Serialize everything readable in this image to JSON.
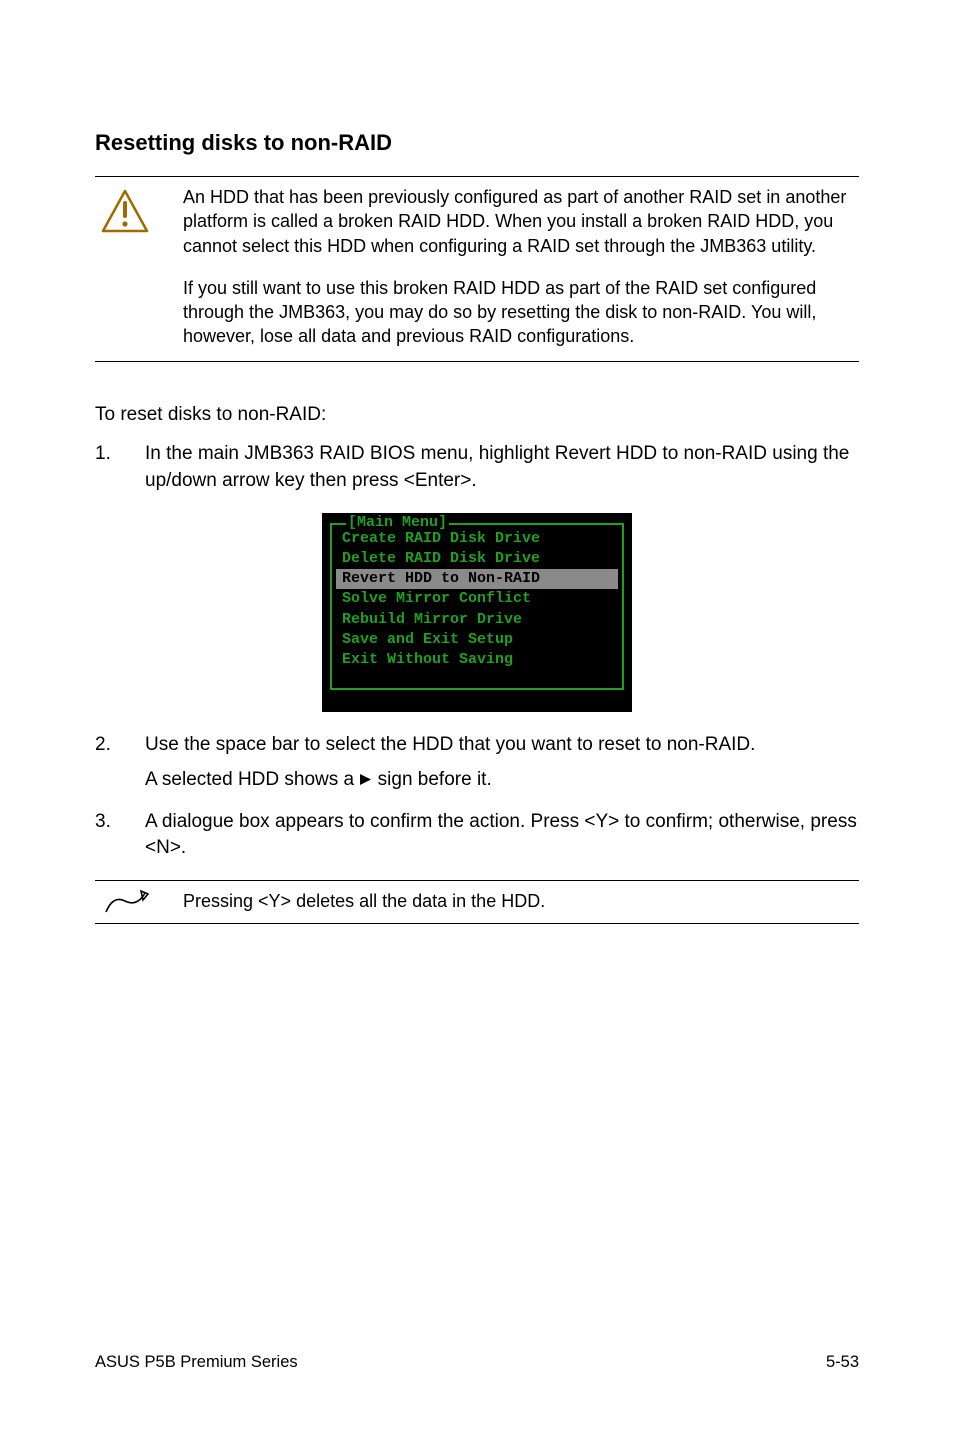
{
  "heading": "Resetting disks to non-RAID",
  "warning": {
    "p1": "An HDD that has been previously configured as part of another RAID set in another platform is called a broken RAID HDD. When you install a broken RAID HDD, you cannot select this HDD when configuring a RAID set through the JMB363 utility.",
    "p2": "If you still want to use this broken RAID HDD as part of the RAID set configured through the JMB363, you may do so by resetting the disk to non-RAID. You will, however, lose all data and previous RAID configurations."
  },
  "intro": "To reset disks to non-RAID:",
  "steps": {
    "s1": {
      "num": "1.",
      "text": "In the main JMB363 RAID BIOS menu, highlight Revert HDD to non-RAID using the up/down arrow key then press <Enter>."
    },
    "s2": {
      "num": "2.",
      "line1": "Use the space bar to select the HDD that you want to reset to non-RAID.",
      "line2a": "A selected HDD shows a ",
      "line2b": " sign before it."
    },
    "s3": {
      "num": "3.",
      "text": "A dialogue box appears to confirm the action. Press <Y> to confirm; otherwise, press <N>."
    }
  },
  "bios": {
    "title": "[Main Menu]",
    "items": [
      "Create RAID Disk Drive",
      "Delete RAID Disk Drive",
      "Revert HDD to Non-RAID",
      "Solve Mirror Conflict",
      "Rebuild Mirror Drive",
      "Save and Exit Setup",
      "Exit Without Saving"
    ],
    "highlight_index": 2
  },
  "pencil_note": "Pressing <Y> deletes all the data in the HDD.",
  "footer": {
    "left": "ASUS P5B Premium Series",
    "right": "5-53"
  }
}
